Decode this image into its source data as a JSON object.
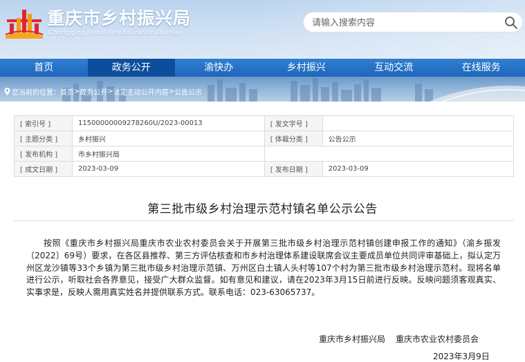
{
  "header": {
    "title": "重庆市乡村振兴局",
    "subtitle": "Chongqing Rural Revitalization Bureau",
    "logo_icon": "government-building-logo-icon",
    "search": {
      "placeholder": "请输入搜索内容",
      "value": "",
      "icon": "search-icon"
    }
  },
  "nav": {
    "items": [
      {
        "label": "首页"
      },
      {
        "label": "政务公开",
        "active": true
      },
      {
        "label": "渝快办"
      },
      {
        "label": "乡村振兴"
      },
      {
        "label": "互动交流"
      },
      {
        "label": "在线服务"
      }
    ]
  },
  "breadcrumb": {
    "prefix": "您当前的位置：",
    "items": [
      "首页",
      "政务公开",
      "法定主动公开内容",
      "公告公示"
    ],
    "separator": ">"
  },
  "meta": {
    "rows": [
      {
        "label1": "[ 索引号 ]",
        "value1": "11500000009278260U/2023-00013",
        "label2": "[ 发文字号 ]",
        "value2": ""
      },
      {
        "label1": "[ 主题分类 ]",
        "value1": "乡村振兴",
        "label2": "[ 体裁分类 ]",
        "value2": "公告公示"
      },
      {
        "label1": "[ 发布机构 ]",
        "value1": "市乡村振兴局",
        "label2": "",
        "value2": ""
      },
      {
        "label1": "[ 成文日期 ]",
        "value1": "2023-03-09",
        "label2": "[ 发布日期 ]",
        "value2": "2023-03-09"
      }
    ]
  },
  "article": {
    "title": "第三批市级乡村治理示范村镇名单公示公告",
    "body": "按照《重庆市乡村振兴局重庆市农业农村委员会关于开展第三批市级乡村治理示范村镇创建申报工作的通知》（渝乡振发〔2022〕69号）要求，在各区县推荐、第三方评估核查和市乡村治理体系建设联席会议主要成员单位共同评审基础上，拟认定万州区龙沙镇等33个乡镇为第三批市级乡村治理示范镇、万州区白土镇人头村等107个村为第三批市级乡村治理示范村。现将名单进行公示，听取社会各界意见，接受广大群众监督。如有意见和建议，请在2023年3月15日前进行反映。反映问题须客观真实、实事求是，反映人需用真实姓名并提供联系方式。联系电话：023-63065737。",
    "signers": [
      "重庆市乡村振兴局",
      "重庆市农业农村委员会"
    ],
    "date": "2023年3月9日"
  },
  "colors": {
    "nav_bg": "#1f66bb",
    "nav_active": "#0d4e9c",
    "header_bg": "#c4daf0"
  }
}
